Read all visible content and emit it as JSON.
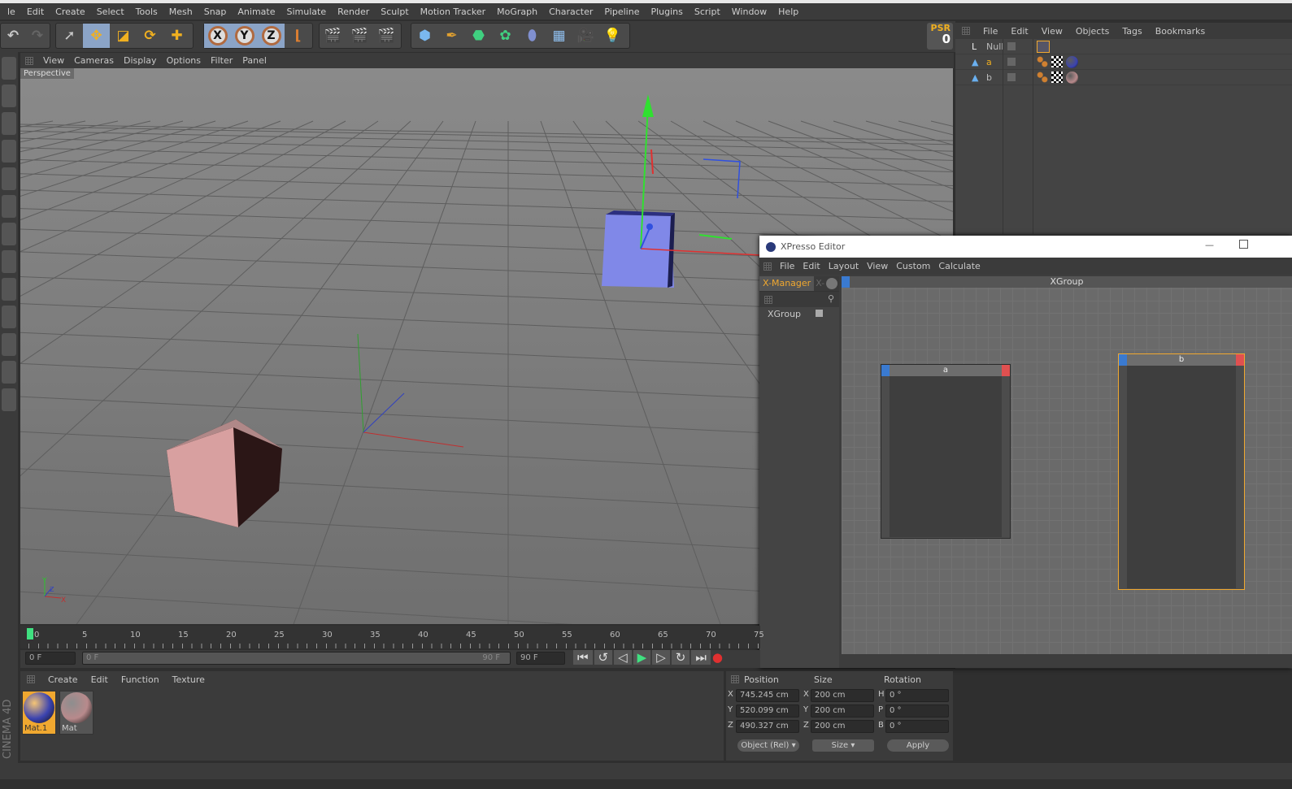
{
  "menu": [
    "le",
    "Edit",
    "Create",
    "Select",
    "Tools",
    "Mesh",
    "Snap",
    "Animate",
    "Simulate",
    "Render",
    "Sculpt",
    "Motion Tracker",
    "MoGraph",
    "Character",
    "Pipeline",
    "Plugins",
    "Script",
    "Window",
    "Help"
  ],
  "toolbar": {
    "axes": [
      "X",
      "Y",
      "Z"
    ],
    "psr_label": "PSR",
    "psr_value": "0"
  },
  "viewport": {
    "menu": [
      "View",
      "Cameras",
      "Display",
      "Options",
      "Filter",
      "Panel"
    ],
    "label": "Perspective",
    "axis_y": "Y",
    "axis_z": "Z",
    "axis_x": "X"
  },
  "object_manager": {
    "menu": [
      "File",
      "Edit",
      "View",
      "Objects",
      "Tags",
      "Bookmarks"
    ],
    "objects": [
      {
        "name": "Null"
      },
      {
        "name": "a"
      },
      {
        "name": "b"
      }
    ]
  },
  "xpresso": {
    "title": "XPresso Editor",
    "menu": [
      "File",
      "Edit",
      "Layout",
      "View",
      "Custom",
      "Calculate"
    ],
    "tab_active": "X-Manager",
    "tab_other": "X-",
    "tree_item": "XGroup",
    "graph_title": "XGroup",
    "nodes": [
      {
        "name": "a"
      },
      {
        "name": "b"
      }
    ]
  },
  "timeline": {
    "ticks": [
      "0",
      "5",
      "10",
      "15",
      "20",
      "25",
      "30",
      "35",
      "40",
      "45",
      "50",
      "55",
      "60",
      "65",
      "70",
      "75"
    ],
    "current": "0 F",
    "range_start": "0 F",
    "range_end": "90 F",
    "end": "90 F"
  },
  "materials": {
    "menu": [
      "Create",
      "Edit",
      "Function",
      "Texture"
    ],
    "items": [
      {
        "name": "Mat.1",
        "color": "#3b43b0"
      },
      {
        "name": "Mat",
        "color": "#b88a8c"
      }
    ]
  },
  "coordinates": {
    "headers": [
      "Position",
      "Size",
      "Rotation"
    ],
    "rows": [
      {
        "axis": "X",
        "pos": "745.245 cm",
        "saxis": "X",
        "size": "200 cm",
        "raxis": "H",
        "rot": "0 °"
      },
      {
        "axis": "Y",
        "pos": "520.099 cm",
        "saxis": "Y",
        "size": "200 cm",
        "raxis": "P",
        "rot": "0 °"
      },
      {
        "axis": "Z",
        "pos": "490.327 cm",
        "saxis": "Z",
        "size": "200 cm",
        "raxis": "B",
        "rot": "0 °"
      }
    ],
    "mode": "Object (Rel)",
    "size_mode": "Size",
    "apply": "Apply"
  },
  "brand": "CINEMA 4D",
  "colors": {
    "accent": "#f0a830",
    "selected": "#8ba4c7"
  }
}
